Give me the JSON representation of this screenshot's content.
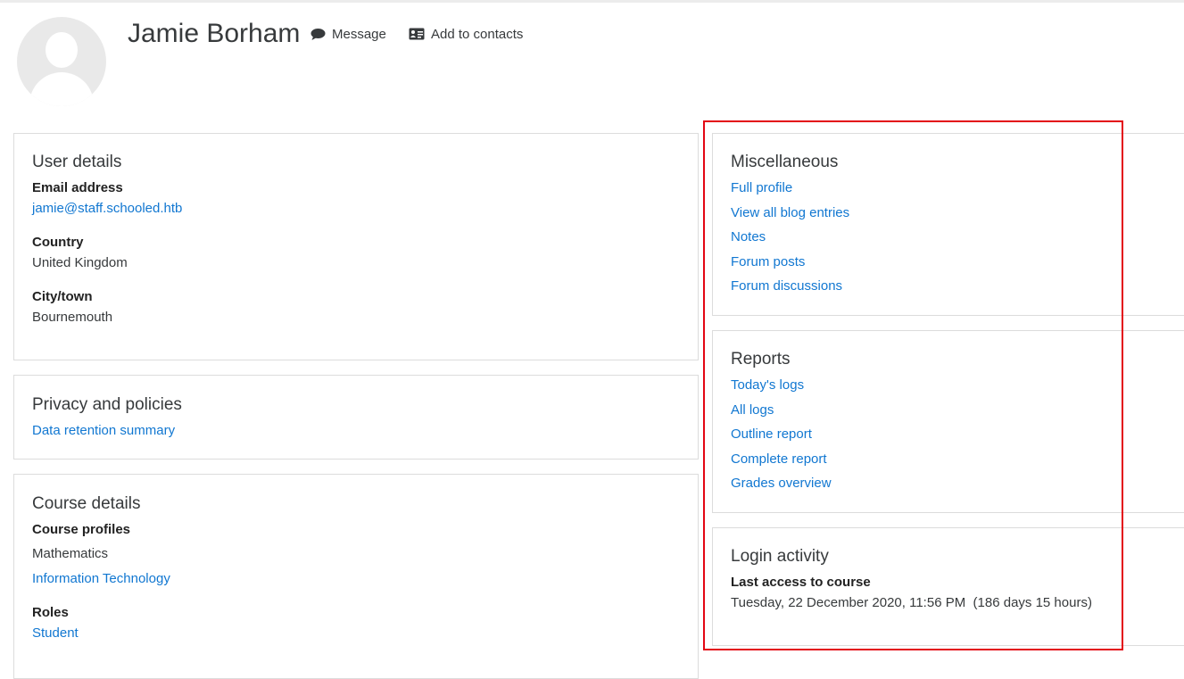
{
  "profile": {
    "name": "Jamie Borham",
    "message_label": "Message",
    "add_contacts_label": "Add to contacts"
  },
  "user_details": {
    "title": "User details",
    "email_label": "Email address",
    "email_value": "jamie@staff.schooled.htb",
    "country_label": "Country",
    "country_value": "United Kingdom",
    "city_label": "City/town",
    "city_value": "Bournemouth"
  },
  "privacy": {
    "title": "Privacy and policies",
    "links": [
      "Data retention summary"
    ]
  },
  "course_details": {
    "title": "Course details",
    "profiles_label": "Course profiles",
    "courses": [
      "Mathematics",
      "Information Technology"
    ],
    "roles_label": "Roles",
    "role": "Student"
  },
  "miscellaneous": {
    "title": "Miscellaneous",
    "links": [
      "Full profile",
      "View all blog entries",
      "Notes",
      "Forum posts",
      "Forum discussions"
    ]
  },
  "reports": {
    "title": "Reports",
    "links": [
      "Today's logs",
      "All logs",
      "Outline report",
      "Complete report",
      "Grades overview"
    ]
  },
  "login_activity": {
    "title": "Login activity",
    "last_access_label": "Last access to course",
    "last_access_value": "Tuesday, 22 December 2020, 11:56 PM  (186 days 15 hours)"
  },
  "colors": {
    "link": "#1177d1",
    "highlight": "#e30613",
    "border": "#dcdcdc"
  },
  "icons": {
    "message": "speech-bubble-icon",
    "contacts": "address-card-icon"
  }
}
